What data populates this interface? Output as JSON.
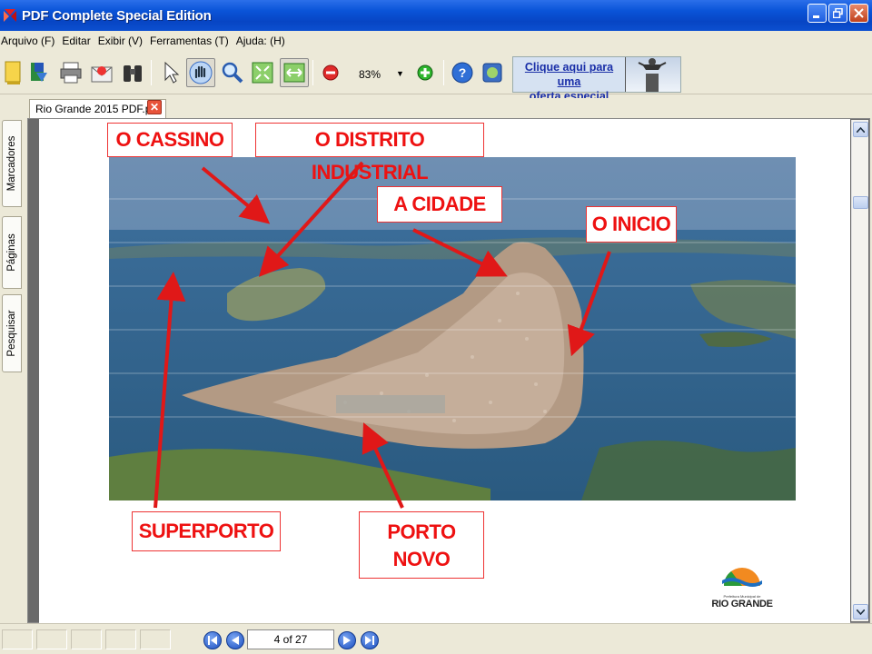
{
  "window": {
    "title": "PDF Complete Special Edition"
  },
  "menu": [
    "Arquivo (F)",
    "Editar",
    "Exibir (V)",
    "Ferramentas (T)",
    "Ajuda: (H)"
  ],
  "toolbar": {
    "zoom_value": "83%",
    "promo_line1": "Clique aqui para uma",
    "promo_line2": "oferta especial"
  },
  "tab": {
    "filename": "Rio Grande 2015 PDF.pdf",
    "close_glyph": "✕"
  },
  "side_tabs": [
    "Marcadores",
    "Páginas",
    "Pesquisar"
  ],
  "slide": {
    "labels": {
      "cassino": "O CASSINO",
      "distrito": "O DISTRITO INDUSTRIAL",
      "cidade": "A CIDADE",
      "inicio": "O INICIO",
      "superporto": "SUPERPORTO",
      "porto_line1": "PORTO",
      "porto_line2": "NOVO"
    },
    "logo_text": "RIO GRANDE",
    "logo_small": "Prefeitura Municipal de"
  },
  "navigation": {
    "page_indicator": "4 of 27"
  },
  "colors": {
    "titlebar": "#0a54d8",
    "label_red": "#e11111",
    "accent_blue": "#1c4fc0"
  }
}
